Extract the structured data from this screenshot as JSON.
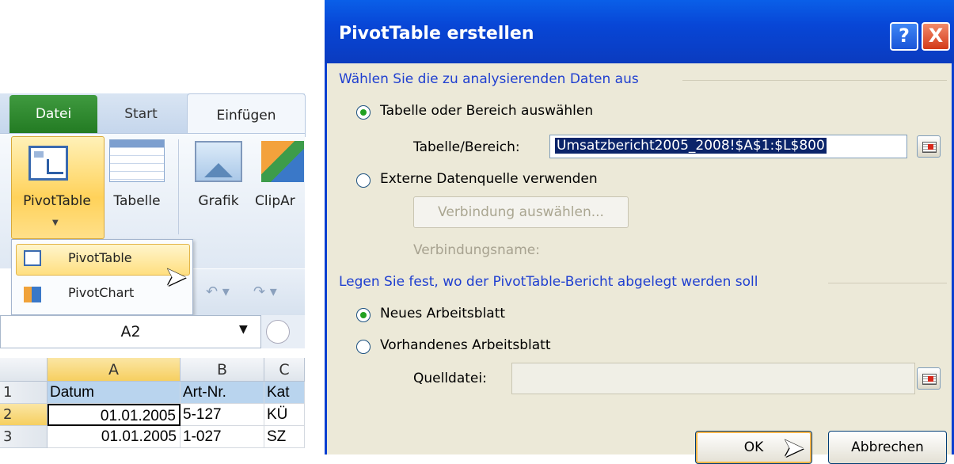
{
  "excel": {
    "tabs": [
      "Datei",
      "Start",
      "Einfügen"
    ],
    "ribbon_buttons": [
      "PivotTable",
      "Tabelle",
      "Grafik",
      "ClipAr"
    ],
    "dropdown_items": [
      "PivotTable",
      "PivotChart"
    ],
    "name_box": "A2",
    "column_headers": [
      "A",
      "B",
      "C"
    ],
    "row_headers": [
      "1",
      "2",
      "3"
    ],
    "cells": [
      [
        "Datum",
        "Art-Nr.",
        "Kat"
      ],
      [
        "01.01.2005",
        "5-127",
        "KÜ"
      ],
      [
        "01.01.2005",
        "1-027",
        "SZ"
      ]
    ]
  },
  "dialog": {
    "title": "PivotTable erstellen",
    "help_label": "?",
    "close_label": "X",
    "section1": "Wählen Sie die zu analysierenden Daten aus",
    "radio_table": "Tabelle oder Bereich auswählen",
    "range_label": "Tabelle/Bereich:",
    "range_value": "Umsatzbericht2005_2008!$A$1:$L$800",
    "radio_external": "Externe Datenquelle verwenden",
    "connection_button": "Verbindung auswählen...",
    "connection_name_label": "Verbindungsname:",
    "section2": "Legen Sie fest, wo der PivotTable-Bericht abgelegt werden soll",
    "radio_new": "Neues Arbeitsblatt",
    "radio_existing": "Vorhandenes Arbeitsblatt",
    "source_label": "Quelldatei:",
    "ok_label": "OK",
    "cancel_label": "Abbrechen"
  }
}
